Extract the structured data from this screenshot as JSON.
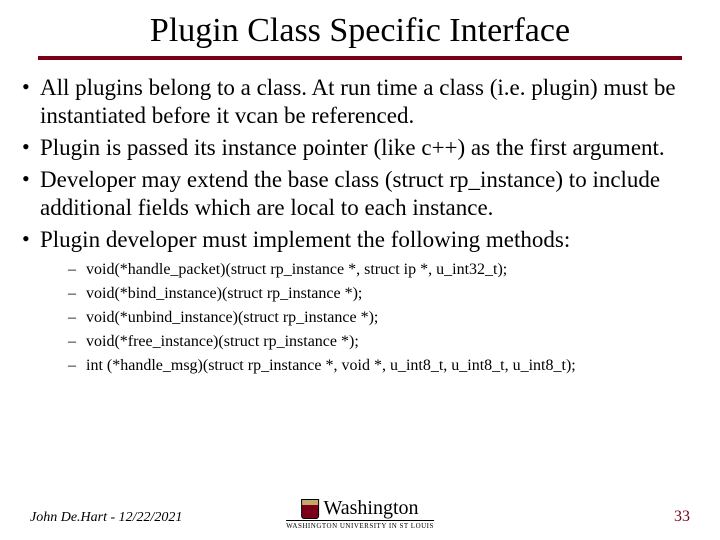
{
  "title": "Plugin Class Specific Interface",
  "bullets": {
    "b0": "All plugins belong to a class.  At run time a class (i.e. plugin) must be instantiated before it vcan be referenced.",
    "b1": "Plugin is passed its instance pointer (like c++) as the first argument.",
    "b2": "Developer may extend the base class (struct rp_instance) to include additional fields which are local to each instance.",
    "b3": "Plugin developer must implement the following methods:"
  },
  "methods": {
    "m0": "void(*handle_packet)(struct rp_instance *, struct ip *, u_int32_t);",
    "m1": "void(*bind_instance)(struct rp_instance *);",
    "m2": "void(*unbind_instance)(struct rp_instance *);",
    "m3": "void(*free_instance)(struct rp_instance *);",
    "m4": "int (*handle_msg)(struct rp_instance *, void *, u_int8_t, u_int8_t, u_int8_t);"
  },
  "footer": {
    "author_date": "John De.Hart - 12/22/2021",
    "logo_main": "Washington",
    "logo_sub": "WASHINGTON UNIVERSITY IN ST LOUIS",
    "page": "33"
  }
}
